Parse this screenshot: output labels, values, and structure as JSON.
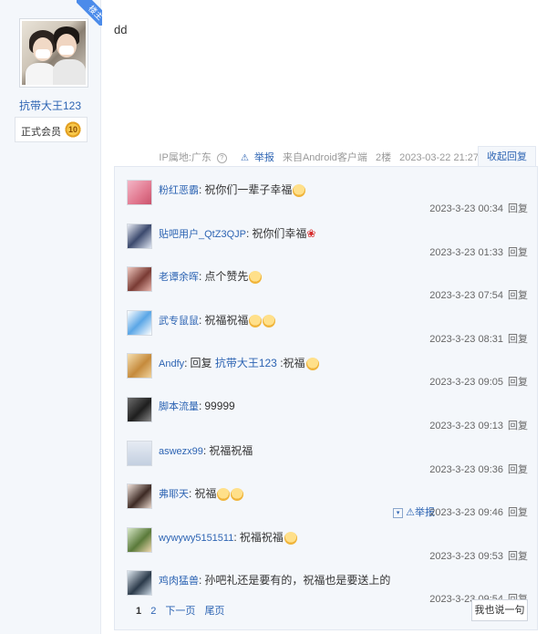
{
  "author": {
    "username": "抗带大王123",
    "corner_badge": "楼主",
    "member_label": "正式会员",
    "member_level": "10"
  },
  "post": {
    "content": "dd"
  },
  "tail": {
    "ip_label": "IP属地:广东",
    "help_icon": "?",
    "report_label": "举报",
    "source": "来自Android客户端",
    "floor": "2楼",
    "time": "2023-03-22 21:27",
    "collapse_label": "收起回复"
  },
  "replies": [
    {
      "name": "粉红恶霸",
      "sep": ":",
      "text": "祝你们一辈子幸福",
      "emoji": 1,
      "time": "2023-3-23 00:34",
      "reply": "回复"
    },
    {
      "name": "贴吧用户_QtZ3QJP",
      "sep": ":",
      "text": "祝你们幸福",
      "emoji": 0,
      "rose": true,
      "time": "2023-3-23 01:33",
      "reply": "回复"
    },
    {
      "name": "老谭余晖",
      "sep": ":",
      "text": "点个赞先",
      "emoji": 1,
      "time": "2023-3-23 07:54",
      "reply": "回复"
    },
    {
      "name": "武专鼠鼠",
      "sep": ":",
      "text": "祝福祝福",
      "emoji": 2,
      "time": "2023-3-23 08:31",
      "reply": "回复"
    },
    {
      "name": "Andfy",
      "sep": ":",
      "text": "回复 ",
      "mention": "抗带大王123",
      "tail": " :祝福",
      "emoji": 1,
      "time": "2023-3-23 09:05",
      "reply": "回复"
    },
    {
      "name": "脚本流量",
      "sep": ":",
      "text": "99999",
      "emoji": 0,
      "time": "2023-3-23 09:13",
      "reply": "回复"
    },
    {
      "name": "aswezx99",
      "sep": ":",
      "text": "祝福祝福",
      "emoji": 0,
      "time": "2023-3-23 09:36",
      "reply": "回复"
    },
    {
      "name": "弗耶天",
      "sep": ":",
      "text": "祝福",
      "emoji": 2,
      "time": "2023-3-23 09:46",
      "reply": "回复",
      "report": "举报"
    },
    {
      "name": "wywywy5151511",
      "sep": ":",
      "text": "祝福祝福",
      "emoji": 1,
      "time": "2023-3-23 09:53",
      "reply": "回复"
    },
    {
      "name": "鸡肉猛兽",
      "sep": ":",
      "text": "孙吧礼还是要有的，祝福也是要送上的",
      "emoji": 0,
      "time": "2023-3-23 09:54",
      "reply": "回复"
    }
  ],
  "pager": {
    "pages": [
      "1",
      "2"
    ],
    "next": "下一页",
    "last": "尾页",
    "say_button": "我也说一句"
  },
  "colors": {
    "link": "#2d64b3",
    "panel_bg": "#f4f7fb",
    "ribbon": "#4b8bea"
  }
}
